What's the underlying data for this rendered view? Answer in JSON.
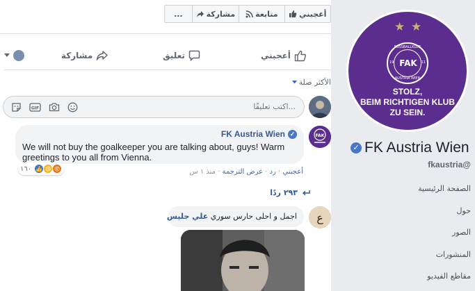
{
  "top_actions": {
    "like": "أعجبني",
    "follow": "متابعة",
    "share": "مشاركة",
    "more": "..."
  },
  "action_bar": {
    "like": "أعجبني",
    "comment": "تعليق",
    "share": "مشاركة"
  },
  "most_relevant": "الأكثر صلة",
  "composer": {
    "placeholder": "اكتب تعليقًا..."
  },
  "comments": [
    {
      "author": "FK Austria Wien",
      "verified": true,
      "text": "We will not buy the goalkeeper you are talking about, guys! Warm greetings to you all from Vienna.",
      "reaction_count": "١٦٠",
      "meta": {
        "like": "أعجبني",
        "reply": "رد",
        "translation": "عرض الترجمة",
        "time": "منذ ١ س"
      },
      "replies_label": "٢٩٣ ردًا"
    },
    {
      "author": "علي جليس",
      "text": "اجمل و احلى حارس سوري"
    }
  ],
  "sidebar": {
    "profile": {
      "crest_top": "FUSSBALLKLUB",
      "crest_letters": "FAK",
      "crest_bottom": "AUSTRIA WIEN",
      "crest_left": "19",
      "crest_right": "11",
      "slogan": [
        "STOLZ,",
        "BEIM RICHTIGEN KLUB",
        "ZU SEIN."
      ]
    },
    "page_name": "FK Austria Wien",
    "handle": "fkaustria@",
    "nav": [
      "الصفحة الرئيسية",
      "حول",
      "الصور",
      "المنشورات",
      "مقاطع الفيديو"
    ]
  },
  "colors": {
    "brand": "#5b2d8e",
    "link": "#385898",
    "verified": "#4a76c7",
    "sidebar_bg": "#e9ebee"
  }
}
